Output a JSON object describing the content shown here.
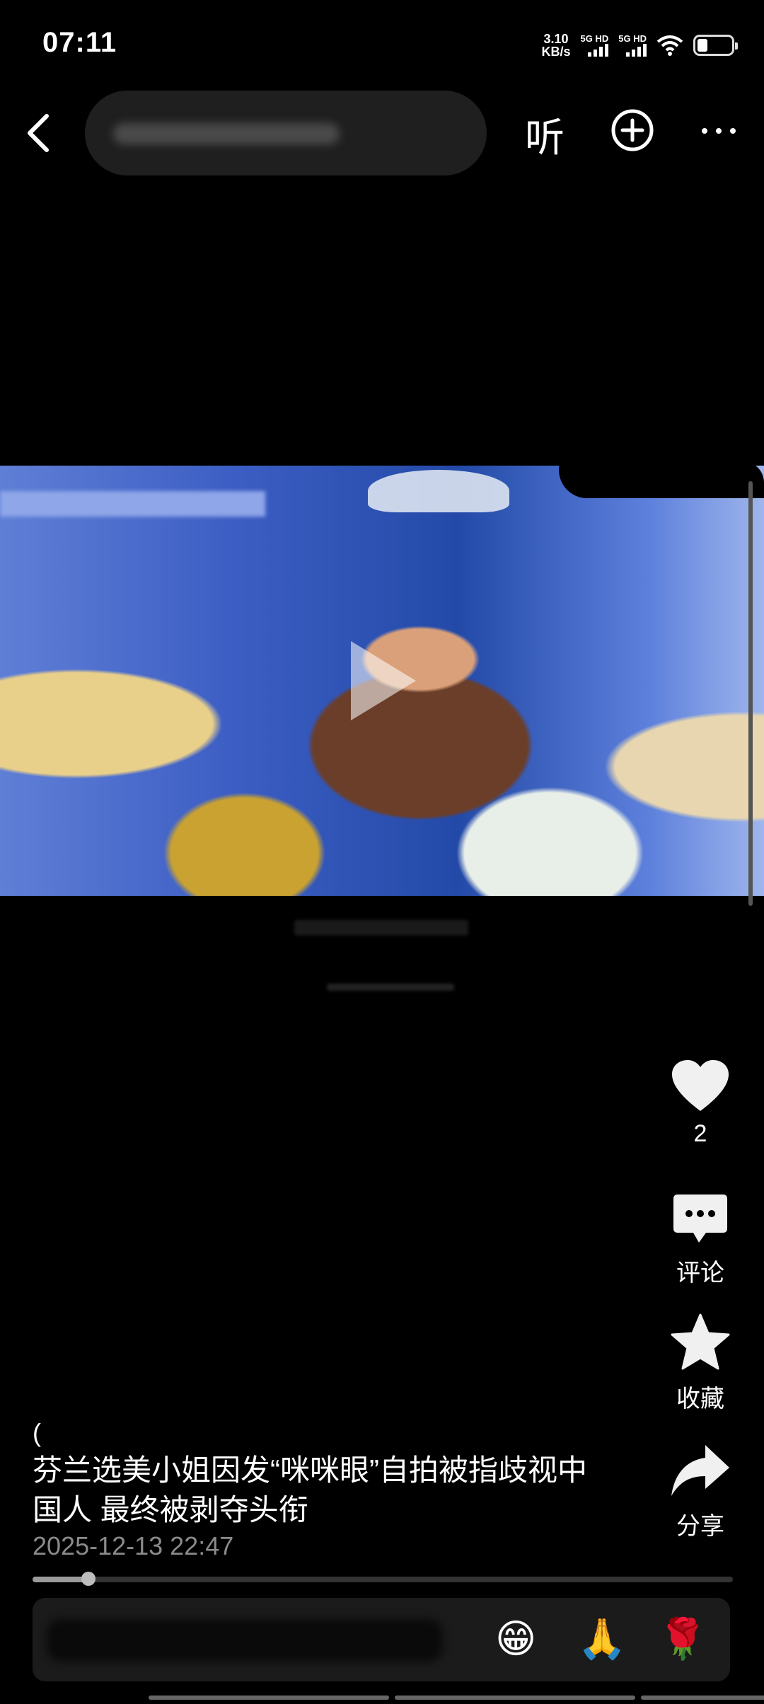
{
  "status_bar": {
    "time": "07:11",
    "net_speed_value": "3.10",
    "net_speed_unit": "KB/s",
    "sim1": "5G HD",
    "sim2": "5G HD"
  },
  "top_bar": {
    "listen_label": "听"
  },
  "actions": {
    "like_count": "2",
    "comment_label": "评论",
    "favorite_label": "收藏",
    "share_label": "分享"
  },
  "post": {
    "loading_mark": "(",
    "caption": "芬兰选美小姐因发“咪咪眼”自拍被指歧视中国人 最终被剥夺头衔",
    "date": "2025-12-13 22:47",
    "progress_fraction": 0.08
  },
  "comment_bar": {
    "emojis": [
      "😁",
      "🙏",
      "🌹"
    ]
  },
  "colors": {
    "background": "#000000",
    "heart": "#f0f0f0",
    "date_text": "#8a8a8a"
  }
}
